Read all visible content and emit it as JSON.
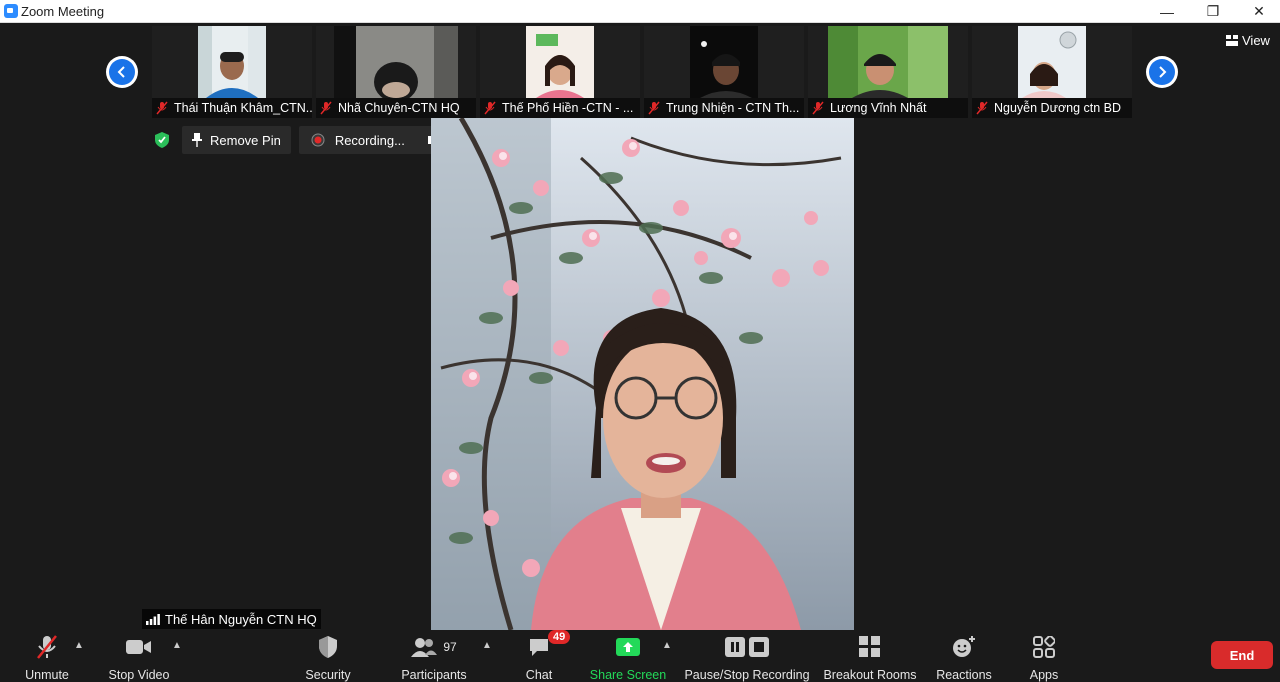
{
  "window": {
    "title": "Zoom Meeting",
    "minimize": "—",
    "restore": "❐",
    "close": "✕"
  },
  "gallery": {
    "view_label": "View",
    "participants": [
      {
        "name": "Thái Thuận Khâm_CTN..."
      },
      {
        "name": "Nhã Chuyên-CTN HQ"
      },
      {
        "name": "Thế Phố Hiền  -CTN - ..."
      },
      {
        "name": "Trung Nhiện - CTN Th..."
      },
      {
        "name": "Lương Vĩnh Nhất"
      },
      {
        "name": "Nguyễn Dương ctn BD"
      }
    ]
  },
  "pin_bar": {
    "remove_pin": "Remove Pin",
    "recording": "Recording..."
  },
  "speaker": {
    "name": "Thế Hân Nguyễn CTN HQ"
  },
  "toolbar": {
    "unmute": "Unmute",
    "stop_video": "Stop Video",
    "security": "Security",
    "participants": "Participants",
    "participants_count": "97",
    "chat": "Chat",
    "chat_badge": "49",
    "share_screen": "Share Screen",
    "pause_stop_recording": "Pause/Stop Recording",
    "breakout_rooms": "Breakout Rooms",
    "reactions": "Reactions",
    "apps": "Apps",
    "end": "End"
  },
  "colors": {
    "accent": "#1a73e8",
    "share_green": "#23d959",
    "end_red": "#d92b2b",
    "badge_red": "#e02828",
    "security_green": "#2bbf5a"
  }
}
